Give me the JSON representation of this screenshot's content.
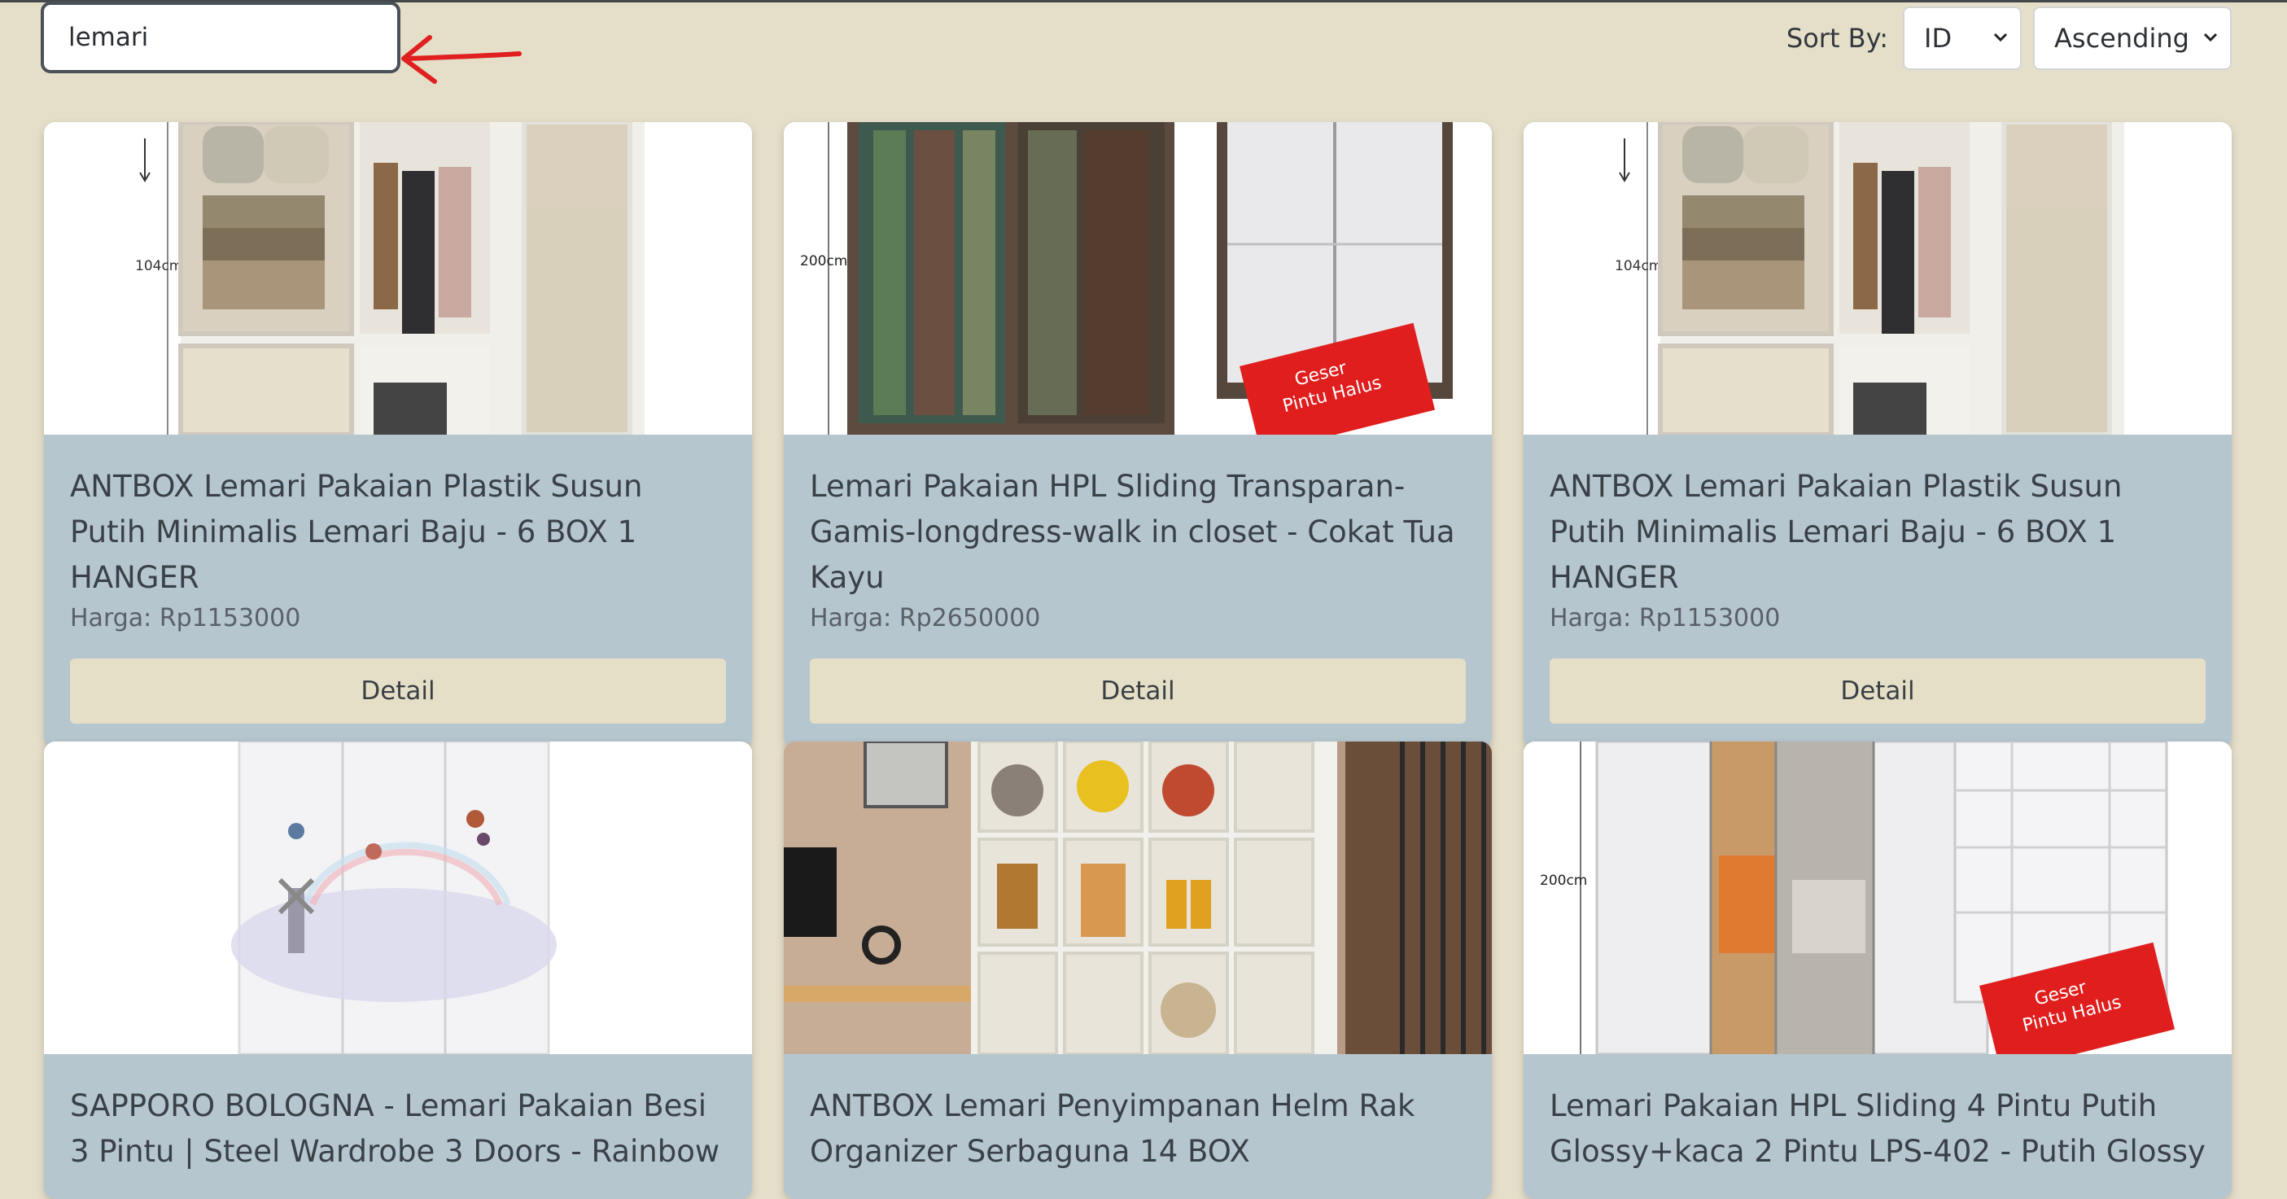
{
  "search": {
    "value": "lemari"
  },
  "sort": {
    "label": "Sort By:",
    "field": "ID",
    "order": "Ascending"
  },
  "products": [
    {
      "title": "ANTBOX Lemari Pakaian Plastik Susun Putih Minimalis Lemari Baju - 6 BOX 1 HANGER",
      "price": "Harga: Rp1153000",
      "button": "Detail",
      "image_label": "104cm"
    },
    {
      "title": "Lemari Pakaian HPL Sliding Transparan-Gamis-longdress-walk in closet - Cokat Tua Kayu",
      "price": "Harga: Rp2650000",
      "button": "Detail",
      "image_label": "200cm",
      "badge_line1": "Geser",
      "badge_line2": "Pintu Halus"
    },
    {
      "title": "ANTBOX Lemari Pakaian Plastik Susun Putih Minimalis Lemari Baju - 6 BOX 1 HANGER",
      "price": "Harga: Rp1153000",
      "button": "Detail",
      "image_label": "104cm"
    },
    {
      "title": "SAPPORO BOLOGNA - Lemari Pakaian Besi 3 Pintu | Steel Wardrobe 3 Doors - Rainbow"
    },
    {
      "title": "ANTBOX Lemari Penyimpanan Helm Rak Organizer Serbaguna 14 BOX"
    },
    {
      "title": "Lemari Pakaian HPL Sliding 4 Pintu Putih Glossy+kaca 2 Pintu LPS-402 - Putih Glossy",
      "image_label": "200cm",
      "badge_line1": "Geser",
      "badge_line2": "Pintu Halus"
    }
  ],
  "colors": {
    "background": "#e5dfca",
    "card": "#b6c6ce",
    "button": "#e6dfc7",
    "annotation": "#e02020"
  }
}
